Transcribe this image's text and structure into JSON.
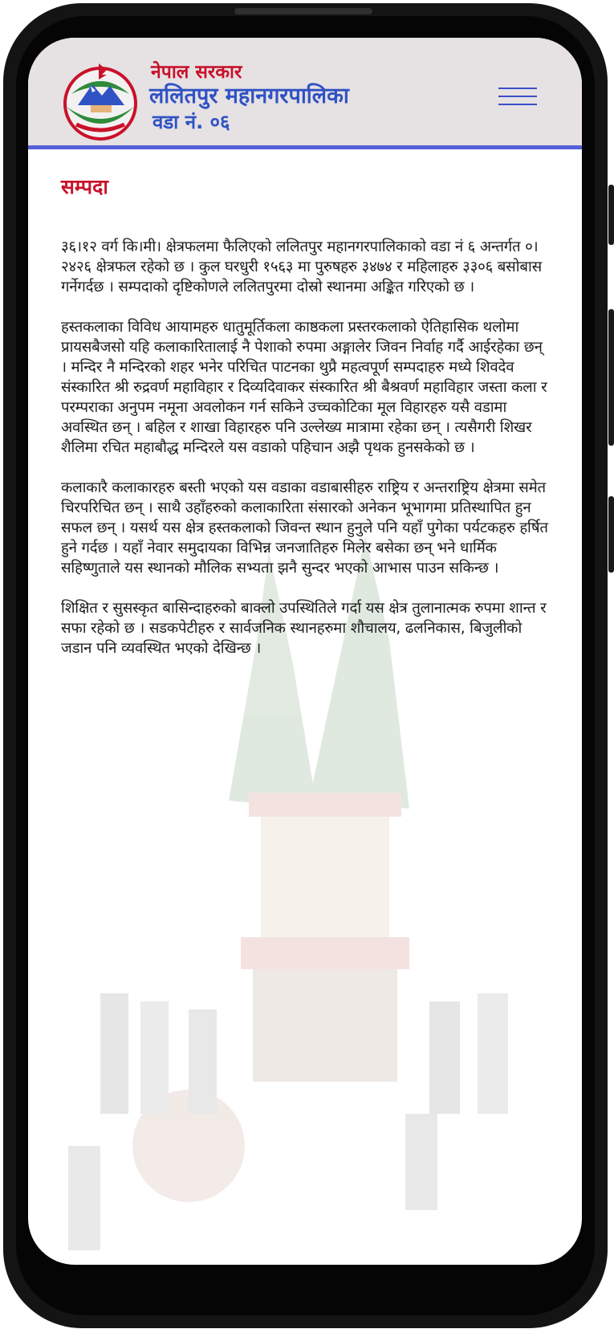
{
  "header": {
    "gov_name": "नेपाल सरकार",
    "municipality": "ललितपुर महानगरपालिका",
    "ward": "वडा नं. ०६",
    "logo_icon": "nepal-government-emblem",
    "menu_icon": "hamburger-menu-icon"
  },
  "page": {
    "title": "सम्पदा",
    "paragraphs": [
      "३६।१२ वर्ग कि।मी। क्षेत्रफलमा फैलिएको ललितपुर महानगरपालिकाको वडा नं ६ अन्तर्गत ०।२४२६ क्षेत्रफल रहेको छ । कुल घरधुरी १५६३ मा पुरुषहरु ३४७४ र महिलाहरु ३३०६ बसोबास गर्नेगर्दछ । सम्पदाको दृष्टिकोणले ललितपुरमा दोस्रो स्थानमा अङ्कित गरिएको छ ।",
      "हस्तकलाका विविध आयामहरु धातुमूर्तिकला काष्ठकला प्रस्तरकलाको ऐतिहासिक थलोमा प्रायसबैजसो यहि कलाकारितालाई नै पेशाको रुपमा अङ्गालेर जिवन निर्वाह गर्दै आईरहेका छन् । मन्दिर नै मन्दिरको शहर भनेर परिचित पाटनका थुप्रै महत्वपूर्ण सम्पदाहरु मध्ये शिवदेव संस्कारित श्री रुद्रवर्ण महाविहार र दिव्यदिवाकर संस्कारित श्री बैश्रवर्ण महाविहार जस्ता कला र परम्पराका अनुपम नमूना अवलोकन गर्न सकिने उच्चकोटिका मूल विहारहरु यसै वडामा अवस्थित छन् । बहिल र शाखा विहारहरु पनि उल्लेख्य मात्रामा रहेका छन् । त्यसैगरी शिखर शैलिमा रचित महाबौद्ध मन्दिरले यस वडाको पहिचान अझै पृथक हुनसकेको छ ।",
      "कलाकारै कलाकारहरु बस्ती भएको यस वडाका वडाबासीहरु राष्ट्रिय र अन्तराष्ट्रिय क्षेत्रमा समेत चिरपरिचित छन् । साथै उहाँहरुको कलाकारिता संसारको अनेकन भूभागमा प्रतिस्थापित हुन सफल छन् । यसर्थ यस क्षेत्र हस्तकलाको जिवन्त स्थान हुनुले पनि यहाँ पुगेका पर्यटकहरु हर्षित हुने गर्दछ । यहाँ नेवार समुदायका विभिन्न जनजातिहरु मिलेर बसेका छन् भने धार्मिक सहिष्णुताले यस स्थानको मौलिक सभ्यता झनै सुन्दर भएको आभास पाउन सकिन्छ ।",
      "शिक्षित र सुसस्कृत बासिन्दाहरुको बाक्लो उपस्थितिले गर्दा यस क्षेत्र तुलानात्मक रुपमा शान्त र सफा रहेको छ । सडकपेटीहरु र सार्वजनिक स्थानहरुमा शौचालय, ढलनिकास, बिजुलीको जडान पनि व्यवस्थित भएको देखिन्छ ।"
    ]
  },
  "colors": {
    "header_bg": "#e6e1e3",
    "accent_red": "#c8112a",
    "accent_blue": "#2f52c4",
    "divider": "#5560d8"
  }
}
